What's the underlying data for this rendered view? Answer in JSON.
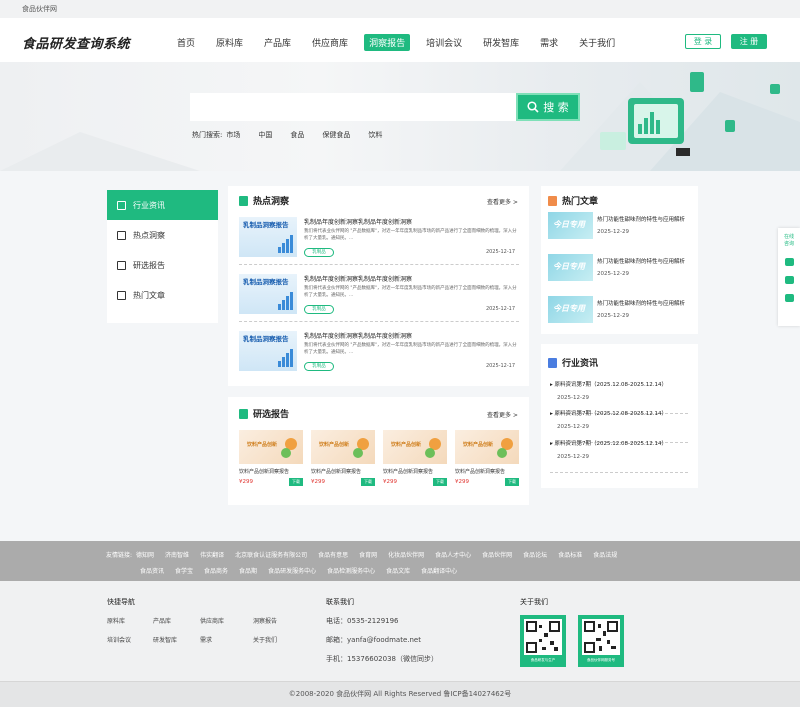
{
  "topbar": {
    "site_name": "食品伙伴网"
  },
  "header": {
    "logo": "食品研发查询系统",
    "nav": [
      "首页",
      "原料库",
      "产品库",
      "供应商库",
      "洞察报告",
      "培训会议",
      "研发智库",
      "需求",
      "关于我们"
    ],
    "active_nav": "洞察报告",
    "login": "登 录",
    "register": "注 册"
  },
  "hero": {
    "search_placeholder": "",
    "search_button": "搜 索",
    "hot_label": "热门搜索:",
    "hot_terms": [
      "市场",
      "中国",
      "食品",
      "保健食品",
      "饮料"
    ]
  },
  "sidebar": {
    "items": [
      "行业资讯",
      "热点洞察",
      "研选报告",
      "热门文章"
    ],
    "active": "行业资讯"
  },
  "insight": {
    "title": "热点洞察",
    "more": "查看更多 >",
    "articles": [
      {
        "thumb_title": "乳制品洞察报告",
        "title": "乳制品年度创新洞察乳制品年度创新洞察",
        "desc": "我们将代表业伙伴网的 \"产品数据库\"，对近一年年度乳制品市场的新产品进行了全面而细致的梳理。深入分析了大量乳。通知民。...",
        "tag": "乳制品",
        "date": "2025-12-17"
      },
      {
        "thumb_title": "乳制品洞察报告",
        "title": "乳制品年度创新洞察乳制品年度创新洞察",
        "desc": "我们将代表业伙伴网的 \"产品数据库\"，对近一年年度乳制品市场的新产品进行了全面而细致的梳理。深入分析了大量乳。通知民。...",
        "tag": "乳制品",
        "date": "2025-12-17"
      },
      {
        "thumb_title": "乳制品洞察报告",
        "title": "乳制品年度创新洞察乳制品年度创新洞察",
        "desc": "我们将代表业伙伴网的 \"产品数据库\"，对近一年年度乳制品市场的新产品进行了全面而细致的梳理。深入分析了大量乳。通知民。...",
        "tag": "乳制品",
        "date": "2025-12-17"
      }
    ]
  },
  "reports": {
    "title": "研选报告",
    "more": "查看更多 >",
    "cards": [
      {
        "img_label": "饮料产品创新",
        "title": "饮料产品创新洞察报告",
        "price": "¥299",
        "badge": "下载"
      },
      {
        "img_label": "饮料产品创新",
        "title": "饮料产品创新洞察报告",
        "price": "¥299",
        "badge": "下载"
      },
      {
        "img_label": "饮料产品创新",
        "title": "饮料产品创新洞察报告",
        "price": "¥299",
        "badge": "下载"
      },
      {
        "img_label": "饮料产品创新",
        "title": "饮料产品创新洞察报告",
        "price": "¥299",
        "badge": "下载"
      }
    ]
  },
  "hot_articles": {
    "title": "热门文章",
    "items": [
      {
        "img_text": "今日专用",
        "title": "热门功能性甜味剂的特性与应用解析",
        "date": "2025-12-29"
      },
      {
        "img_text": "今日专用",
        "title": "热门功能性甜味剂的特性与应用解析",
        "date": "2025-12-29"
      },
      {
        "img_text": "今日专用",
        "title": "热门功能性甜味剂的特性与应用解析",
        "date": "2025-12-29"
      }
    ]
  },
  "industry_news": {
    "title": "行业资讯",
    "items": [
      {
        "title": "原料资讯第7期（2025.12.08-2025.12.14）",
        "date": "2025-12-29"
      },
      {
        "title": "原料资讯第7期（2025.12.08-2025.12.14）",
        "date": "2025-12-29"
      },
      {
        "title": "原料资讯第7期（2025.12.08-2025.12.14）",
        "date": "2025-12-29"
      }
    ]
  },
  "friend_links": {
    "label": "友情链接:",
    "row1": [
      "德知网",
      "济南智维",
      "伟实翻译",
      "北京联食认证服务有限公司",
      "食品有意思",
      "食育网",
      "化妆品伙伴网",
      "食品人才中心",
      "食品伙伴网",
      "食品论坛",
      "食品标准",
      "食品法规"
    ],
    "row2": [
      "食品资讯",
      "食学宝",
      "食品商务",
      "食品期",
      "食品研发服务中心",
      "食品检测服务中心",
      "食品文库",
      "食品翻译中心"
    ]
  },
  "footer": {
    "nav_title": "快捷导航",
    "nav_links": [
      "原料库",
      "产品库",
      "供应商库",
      "洞察报告",
      "培训会议",
      "研发智库",
      "需求",
      "关于我们"
    ],
    "contact_title": "联系我们",
    "phone": "电话：0535-2129196",
    "email": "邮箱：yanfa@foodmate.net",
    "mobile": "手机：15376602038（微信同步）",
    "about_title": "关于我们",
    "qr_captions": [
      "食品研发与生产",
      "食品伙伴网服务号"
    ],
    "copyright": "©2008-2020 食品伙伴网 All Rights Reserved 鲁ICP备14027462号"
  },
  "float_bar": {
    "online": "在线\n咨询"
  },
  "colors": {
    "accent": "#1fba80",
    "friend_bg": "#ababab"
  }
}
